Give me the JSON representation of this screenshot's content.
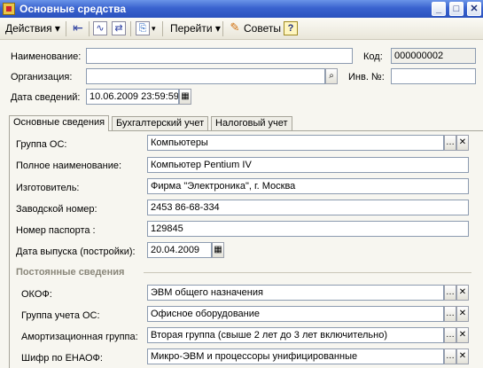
{
  "window": {
    "title": "Основные средства",
    "controls": [
      "_",
      "□",
      "✕"
    ]
  },
  "toolbar": {
    "actions_label": "Действия",
    "goto_label": "Перейти",
    "tips_label": "Советы",
    "help_label": "?"
  },
  "header": {
    "name_label": "Наименование:",
    "name_value": "",
    "code_label": "Код:",
    "code_value": "000000002",
    "org_label": "Организация:",
    "org_value": "",
    "inv_label": "Инв. №:",
    "inv_value": "",
    "date_label": "Дата сведений:",
    "date_value": "10.06.2009 23:59:59"
  },
  "tabs": [
    "Основные сведения",
    "Бухгалтерский учет",
    "Налоговый учет"
  ],
  "main": {
    "group_label": "Группа ОС:",
    "group_value": "Компьютеры",
    "fullname_label": "Полное наименование:",
    "fullname_value": "Компьютер Pentium IV",
    "maker_label": "Изготовитель:",
    "maker_value": "Фирма \"Электроника\", г. Москва",
    "serial_label": "Заводской номер:",
    "serial_value": "2453 86-68-334",
    "passport_label": "Номер паспорта :",
    "passport_value": "129845",
    "release_label": "Дата выпуска (постройки):",
    "release_value": "20.04.2009",
    "section_title": "Постоянные сведения",
    "okof_label": "ОКОФ:",
    "okof_value": "ЭВМ общего назначения",
    "acc_group_label": "Группа учета ОС:",
    "acc_group_value": "Офисное оборудование",
    "amort_label": "Амортизационная группа:",
    "amort_value": "Вторая группа (свыше 2 лет до 3 лет включительно)",
    "enaof_label": "Шифр по ЕНАОФ:",
    "enaof_value": "Микро-ЭВМ и процессоры унифицированные"
  }
}
